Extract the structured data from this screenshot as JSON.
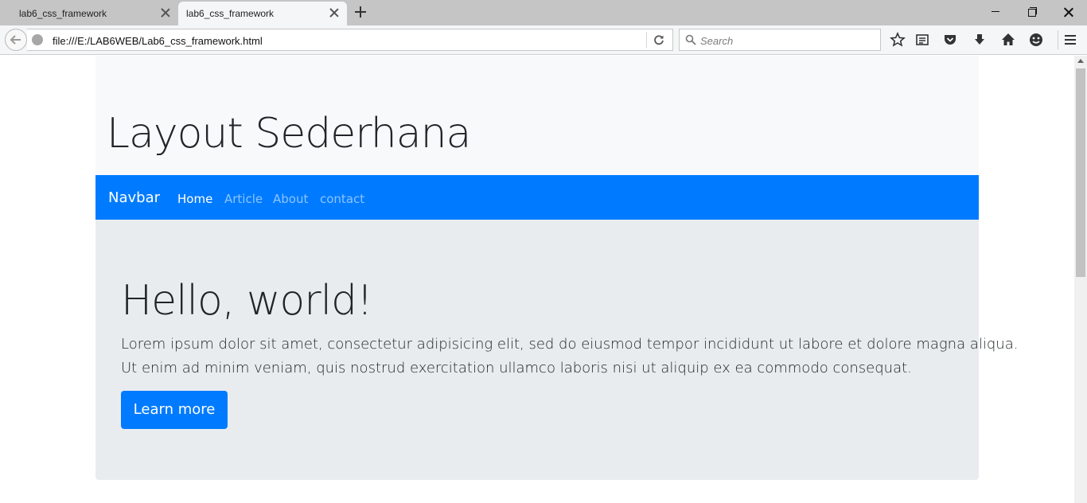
{
  "browser": {
    "tabs": [
      {
        "title": "lab6_css_framework",
        "active": false
      },
      {
        "title": "lab6_css_framework",
        "active": true
      }
    ],
    "url": "file:///E:/LAB6WEB/Lab6_css_framework.html",
    "search_placeholder": "Search",
    "toolbar_icons": [
      "star-icon",
      "reading-list-icon",
      "pocket-icon",
      "download-icon",
      "home-icon",
      "smiley-icon",
      "menu-icon"
    ]
  },
  "page": {
    "header_title": "Layout Sederhana",
    "navbar": {
      "brand": "Navbar",
      "links": [
        "Home",
        "Article",
        "About",
        "contact"
      ],
      "active_link": "Home"
    },
    "jumbotron": {
      "title": "Hello, world!",
      "lead_lines": [
        "Lorem ipsum dolor sit amet, consectetur adipisicing elit, sed do eiusmod tempor incididunt ut labore et dolore magna aliqua.",
        "Ut enim ad minim veniam, quis nostrud exercitation ullamco laboris nisi ut aliquip ex ea commodo consequat."
      ],
      "button_label": "Learn more"
    }
  },
  "colors": {
    "primary": "#007bff",
    "header_bg": "#f8f9fa",
    "jumbotron_bg": "#e9ecef",
    "text": "#212529"
  }
}
